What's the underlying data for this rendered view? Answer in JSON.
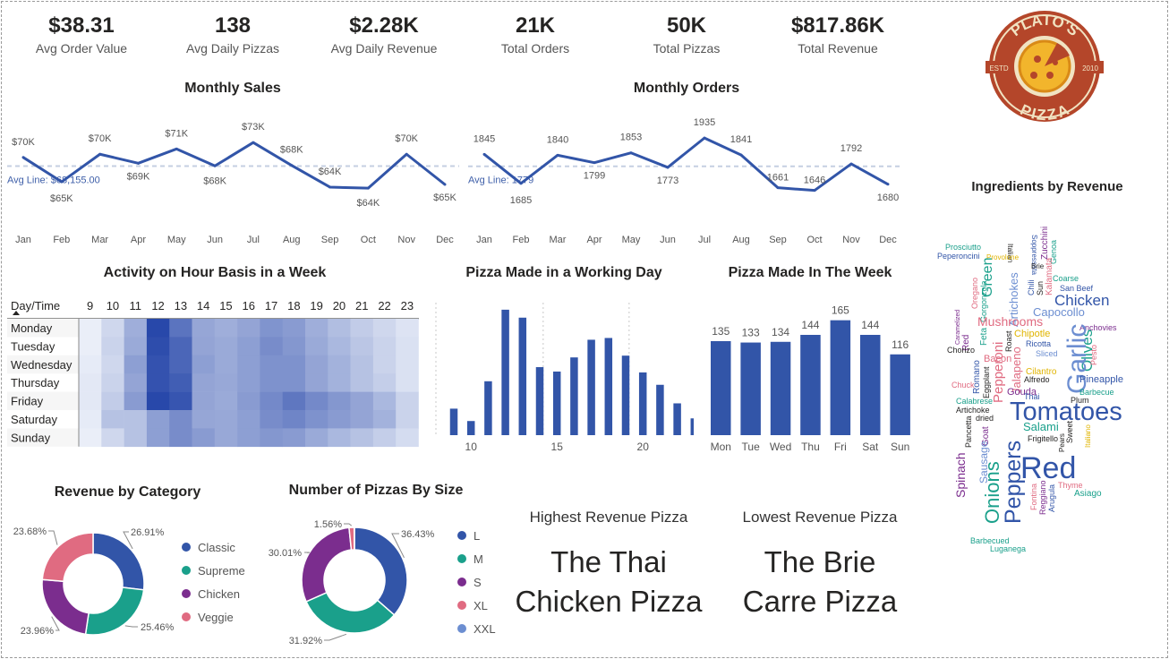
{
  "kpis": [
    {
      "value": "$38.31",
      "label": "Avg Order Value"
    },
    {
      "value": "138",
      "label": "Avg Daily Pizzas"
    },
    {
      "value": "$2.28K",
      "label": "Avg Daily Revenue"
    },
    {
      "value": "21K",
      "label": "Total Orders"
    },
    {
      "value": "50K",
      "label": "Total Pizzas"
    },
    {
      "value": "$817.86K",
      "label": "Total Revenue"
    }
  ],
  "logo": {
    "top_text": "PLATO'S",
    "bottom_text": "PIZZA",
    "left_text": "ESTD",
    "right_text": "2010"
  },
  "colors": {
    "primary": "#3255a8",
    "teal": "#1aa08b",
    "purple": "#7b2d8e",
    "pink": "#e06b81",
    "lightblue": "#6c8ed1",
    "avg_line": "#c5cfe2"
  },
  "highest": {
    "title": "Highest Revenue Pizza",
    "line1": "The Thai",
    "line2": "Chicken Pizza"
  },
  "lowest": {
    "title": "Lowest Revenue Pizza",
    "line1": "The Brie",
    "line2": "Carre Pizza"
  },
  "chart_data": [
    {
      "id": "monthly_sales",
      "type": "line",
      "title": "Monthly Sales",
      "categories": [
        "Jan",
        "Feb",
        "Mar",
        "Apr",
        "May",
        "Jun",
        "Jul",
        "Aug",
        "Sep",
        "Oct",
        "Nov",
        "Dec"
      ],
      "values": [
        69.8,
        65.2,
        70.4,
        68.7,
        71.4,
        68.2,
        72.6,
        68.3,
        64.2,
        64.0,
        70.4,
        64.7
      ],
      "data_labels": [
        "$70K",
        "$65K",
        "$70K",
        "$69K",
        "$71K",
        "$68K",
        "$73K",
        "$68K",
        "$64K",
        "$64K",
        "$70K",
        "$65K"
      ],
      "reference_line": {
        "label": "Avg Line: $68,155.00",
        "value": 68.155
      },
      "ylim": [
        62,
        75
      ]
    },
    {
      "id": "monthly_orders",
      "type": "line",
      "title": "Monthly Orders",
      "categories": [
        "Jan",
        "Feb",
        "Mar",
        "Apr",
        "May",
        "Jun",
        "Jul",
        "Aug",
        "Sep",
        "Oct",
        "Nov",
        "Dec"
      ],
      "values": [
        1845,
        1685,
        1840,
        1799,
        1853,
        1773,
        1935,
        1841,
        1661,
        1646,
        1792,
        1680
      ],
      "data_labels": [
        "1845",
        "1685",
        "1840",
        "1799",
        "1853",
        "1773",
        "1935",
        "1841",
        "1661",
        "1646",
        "1792",
        "1680"
      ],
      "reference_line": {
        "label": "Avg Line: 1779",
        "value": 1779
      },
      "ylim": [
        1600,
        1980
      ]
    },
    {
      "id": "hour_activity",
      "type": "heatmap",
      "title": "Activity on Hour Basis in a Week",
      "corner_label": "Day/Time",
      "x": [
        "9",
        "10",
        "11",
        "12",
        "13",
        "14",
        "15",
        "16",
        "17",
        "18",
        "19",
        "20",
        "21",
        "22",
        "23"
      ],
      "y": [
        "Monday",
        "Tuesday",
        "Wednesday",
        "Thursday",
        "Friday",
        "Saturday",
        "Sunday"
      ],
      "values": [
        [
          1,
          10,
          30,
          88,
          62,
          34,
          30,
          35,
          44,
          40,
          30,
          22,
          15,
          10,
          5
        ],
        [
          1,
          12,
          32,
          85,
          70,
          35,
          32,
          38,
          48,
          42,
          32,
          25,
          18,
          12,
          6
        ],
        [
          2,
          10,
          38,
          82,
          70,
          38,
          32,
          38,
          45,
          45,
          35,
          28,
          20,
          12,
          6
        ],
        [
          3,
          12,
          35,
          82,
          75,
          35,
          33,
          38,
          45,
          45,
          35,
          28,
          20,
          14,
          6
        ],
        [
          3,
          15,
          40,
          88,
          80,
          35,
          32,
          40,
          50,
          60,
          50,
          42,
          35,
          25,
          12
        ],
        [
          2,
          20,
          20,
          38,
          48,
          34,
          33,
          38,
          48,
          52,
          45,
          40,
          35,
          28,
          12
        ],
        [
          1,
          10,
          20,
          38,
          48,
          40,
          33,
          38,
          42,
          40,
          32,
          25,
          20,
          14,
          8
        ]
      ]
    },
    {
      "id": "pizza_working_day",
      "type": "bar",
      "title": "Pizza Made in a Working Day",
      "categories": [
        9,
        10,
        11,
        12,
        13,
        14,
        15,
        16,
        17,
        18,
        19,
        20,
        21,
        22,
        23
      ],
      "values": [
        30,
        16,
        61,
        142,
        133,
        77,
        72,
        88,
        108,
        110,
        90,
        71,
        57,
        36,
        19
      ],
      "tick_labels": [
        "10",
        "15",
        "20"
      ],
      "ylim": [
        0,
        150
      ]
    },
    {
      "id": "pizza_week",
      "type": "bar",
      "title": "Pizza Made In The Week",
      "categories": [
        "Mon",
        "Tue",
        "Wed",
        "Thu",
        "Fri",
        "Sat",
        "Sun"
      ],
      "values": [
        135,
        133,
        134,
        144,
        165,
        144,
        116
      ],
      "data_labels": [
        "135",
        "133",
        "134",
        "144",
        "165",
        "144",
        "116"
      ],
      "ylim": [
        0,
        180
      ]
    },
    {
      "id": "revenue_category",
      "type": "pie",
      "title": "Revenue by Category",
      "labels": [
        "Classic",
        "Supreme",
        "Chicken",
        "Veggie"
      ],
      "values": [
        26.91,
        25.46,
        23.96,
        23.68
      ],
      "data_labels": [
        "26.91%",
        "25.46%",
        "23.96%",
        "23.68%"
      ],
      "colors": [
        "#3255a8",
        "#1aa08b",
        "#7b2d8e",
        "#e06b81"
      ]
    },
    {
      "id": "pizzas_size",
      "type": "pie",
      "title": "Number of Pizzas By Size",
      "labels": [
        "L",
        "M",
        "S",
        "XL",
        "XXL"
      ],
      "values": [
        36.43,
        31.92,
        30.01,
        1.56,
        0.08
      ],
      "data_labels": [
        "36.43%",
        "31.92%",
        "30.01%",
        "1.56%",
        ""
      ],
      "colors": [
        "#3255a8",
        "#1aa08b",
        "#7b2d8e",
        "#e06b81",
        "#6c8ed1"
      ]
    }
  ],
  "wordcloud": {
    "title": "Ingredients by Revenue",
    "words": [
      {
        "t": "Prosciutto",
        "x": 1056,
        "y": 279,
        "s": 9,
        "c": "#1aa08b",
        "r": 0
      },
      {
        "t": "Peperoncini",
        "x": 1047,
        "y": 289,
        "s": 9,
        "c": "#3255a8",
        "r": 0
      },
      {
        "t": "Italian",
        "x": 1126,
        "y": 272,
        "s": 8,
        "c": "#252423",
        "r": 90
      },
      {
        "t": "Soppressata",
        "x": 1153,
        "y": 262,
        "s": 8,
        "c": "#3255a8",
        "r": 90
      },
      {
        "t": "Zucchini",
        "x": 1170,
        "y": 290,
        "s": 10,
        "c": "#7b2d8e",
        "r": -90
      },
      {
        "t": "Genoa",
        "x": 1180,
        "y": 295,
        "s": 9,
        "c": "#1aa08b",
        "r": -90
      },
      {
        "t": "Provolone",
        "x": 1102,
        "y": 290,
        "s": 8,
        "c": "#e0b400",
        "r": 0
      },
      {
        "t": "Green",
        "x": 1108,
        "y": 332,
        "s": 16,
        "c": "#1aa08b",
        "r": -90
      },
      {
        "t": "Artichokes",
        "x": 1137,
        "y": 365,
        "s": 13,
        "c": "#6c8ed1",
        "r": -90
      },
      {
        "t": "Brie",
        "x": 1152,
        "y": 300,
        "s": 8,
        "c": "#252423",
        "r": 0
      },
      {
        "t": "Chili",
        "x": 1155,
        "y": 330,
        "s": 9,
        "c": "#3255a8",
        "r": -90
      },
      {
        "t": "Sun",
        "x": 1165,
        "y": 330,
        "s": 9,
        "c": "#252423",
        "r": -90
      },
      {
        "t": "Kalamata",
        "x": 1175,
        "y": 330,
        "s": 10,
        "c": "#e06b81",
        "r": -90
      },
      {
        "t": "Coarse",
        "x": 1176,
        "y": 314,
        "s": 9,
        "c": "#1aa08b",
        "r": 0
      },
      {
        "t": "San Beef",
        "x": 1184,
        "y": 325,
        "s": 9,
        "c": "#3255a8",
        "r": 0
      },
      {
        "t": "Chicken",
        "x": 1178,
        "y": 341,
        "s": 17,
        "c": "#3255a8",
        "r": 0
      },
      {
        "t": "Capocollo",
        "x": 1154,
        "y": 353,
        "s": 13,
        "c": "#6c8ed1",
        "r": 0
      },
      {
        "t": "Oregano",
        "x": 1092,
        "y": 345,
        "s": 9,
        "c": "#e06b81",
        "r": -90
      },
      {
        "t": "Gorgonzola",
        "x": 1102,
        "y": 360,
        "s": 9,
        "c": "#1aa08b",
        "r": -90
      },
      {
        "t": "Mushrooms",
        "x": 1092,
        "y": 364,
        "s": 14,
        "c": "#e06b81",
        "r": 0
      },
      {
        "t": "Caramelized",
        "x": 1072,
        "y": 385,
        "s": 7,
        "c": "#7b2d8e",
        "r": -90
      },
      {
        "t": "Anchovies",
        "x": 1206,
        "y": 369,
        "s": 9,
        "c": "#7b2d8e",
        "r": 0
      },
      {
        "t": "Chipotle",
        "x": 1133,
        "y": 376,
        "s": 11,
        "c": "#e0b400",
        "r": 0
      },
      {
        "t": "Olives",
        "x": 1220,
        "y": 415,
        "s": 17,
        "c": "#1aa08b",
        "r": -90
      },
      {
        "t": "Feta",
        "x": 1102,
        "y": 386,
        "s": 10,
        "c": "#1aa08b",
        "r": -90
      },
      {
        "t": "Red",
        "x": 1082,
        "y": 392,
        "s": 10,
        "c": "#7b2d8e",
        "r": -90
      },
      {
        "t": "Ricotta",
        "x": 1146,
        "y": 387,
        "s": 9,
        "c": "#3255a8",
        "r": 0
      },
      {
        "t": "Chorizo",
        "x": 1058,
        "y": 394,
        "s": 9,
        "c": "#252423",
        "r": 0
      },
      {
        "t": "Sliced",
        "x": 1157,
        "y": 398,
        "s": 9,
        "c": "#6c8ed1",
        "r": 0
      },
      {
        "t": "Garlic",
        "x": 1213,
        "y": 440,
        "s": 30,
        "c": "#6c8ed1",
        "r": -90
      },
      {
        "t": "Roast",
        "x": 1130,
        "y": 393,
        "s": 9,
        "c": "#252423",
        "r": -90
      },
      {
        "t": "Bacon",
        "x": 1099,
        "y": 404,
        "s": 11,
        "c": "#e06b81",
        "r": 0
      },
      {
        "t": "Pesto",
        "x": 1225,
        "y": 408,
        "s": 9,
        "c": "#e06b81",
        "r": -90
      },
      {
        "t": "Jalapeno",
        "x": 1140,
        "y": 440,
        "s": 13,
        "c": "#e06b81",
        "r": -90
      },
      {
        "t": "Cilantro",
        "x": 1146,
        "y": 418,
        "s": 10,
        "c": "#e0b400",
        "r": 0
      },
      {
        "t": "Pineapple",
        "x": 1206,
        "y": 427,
        "s": 11,
        "c": "#3255a8",
        "r": 0
      },
      {
        "t": "Alfredo",
        "x": 1144,
        "y": 427,
        "s": 9,
        "c": "#252423",
        "r": 0
      },
      {
        "t": "Chuck",
        "x": 1063,
        "y": 433,
        "s": 9,
        "c": "#e06b81",
        "r": 0
      },
      {
        "t": "Romano",
        "x": 1094,
        "y": 440,
        "s": 10,
        "c": "#3255a8",
        "r": -90
      },
      {
        "t": "Pepperoni",
        "x": 1120,
        "y": 450,
        "s": 15,
        "c": "#e06b81",
        "r": -90
      },
      {
        "t": "Gouda",
        "x": 1125,
        "y": 441,
        "s": 11,
        "c": "#7b2d8e",
        "r": 0
      },
      {
        "t": "Barbecue",
        "x": 1206,
        "y": 441,
        "s": 9,
        "c": "#1aa08b",
        "r": 0
      },
      {
        "t": "Calabrese",
        "x": 1068,
        "y": 451,
        "s": 9,
        "c": "#1aa08b",
        "r": 0
      },
      {
        "t": "Eggplant",
        "x": 1105,
        "y": 445,
        "s": 9,
        "c": "#252423",
        "r": -90
      },
      {
        "t": "Thai",
        "x": 1144,
        "y": 446,
        "s": 9,
        "c": "#3255a8",
        "r": 0
      },
      {
        "t": "Plum",
        "x": 1196,
        "y": 450,
        "s": 9,
        "c": "#252423",
        "r": 0
      },
      {
        "t": "Artichoke",
        "x": 1068,
        "y": 461,
        "s": 9,
        "c": "#252423",
        "r": 0
      },
      {
        "t": "Tomatoes",
        "x": 1128,
        "y": 469,
        "s": 29,
        "c": "#3255a8",
        "r": 0
      },
      {
        "t": "dried",
        "x": 1090,
        "y": 470,
        "s": 9,
        "c": "#252423",
        "r": 0
      },
      {
        "t": "Salami",
        "x": 1143,
        "y": 481,
        "s": 13,
        "c": "#1aa08b",
        "r": 0
      },
      {
        "t": "Pancetta",
        "x": 1085,
        "y": 500,
        "s": 9,
        "c": "#252423",
        "r": -90
      },
      {
        "t": "Goat",
        "x": 1104,
        "y": 498,
        "s": 10,
        "c": "#7b2d8e",
        "r": -90
      },
      {
        "t": "Onions",
        "x": 1116,
        "y": 585,
        "s": 22,
        "c": "#1aa08b",
        "r": -90
      },
      {
        "t": "Peppers",
        "x": 1140,
        "y": 585,
        "s": 25,
        "c": "#3255a8",
        "r": -90
      },
      {
        "t": "Red",
        "x": 1140,
        "y": 534,
        "s": 34,
        "c": "#3255a8",
        "r": 0
      },
      {
        "t": "Frigitello",
        "x": 1148,
        "y": 493,
        "s": 9,
        "c": "#252423",
        "r": 0
      },
      {
        "t": "Sweet",
        "x": 1198,
        "y": 495,
        "s": 9,
        "c": "#252423",
        "r": -90
      },
      {
        "t": "Italiano",
        "x": 1218,
        "y": 500,
        "s": 8,
        "c": "#e0b400",
        "r": -90
      },
      {
        "t": "Pears",
        "x": 1189,
        "y": 505,
        "s": 8,
        "c": "#252423",
        "r": -90
      },
      {
        "t": "Spinach",
        "x": 1078,
        "y": 556,
        "s": 14,
        "c": "#7b2d8e",
        "r": -90
      },
      {
        "t": "Sausage",
        "x": 1103,
        "y": 540,
        "s": 12,
        "c": "#6c8ed1",
        "r": -90
      },
      {
        "t": "Thyme",
        "x": 1182,
        "y": 545,
        "s": 9,
        "c": "#e06b81",
        "r": 0
      },
      {
        "t": "Asiago",
        "x": 1200,
        "y": 554,
        "s": 10,
        "c": "#1aa08b",
        "r": 0
      },
      {
        "t": "Fontina",
        "x": 1158,
        "y": 570,
        "s": 9,
        "c": "#e06b81",
        "r": -90
      },
      {
        "t": "Reggiano",
        "x": 1168,
        "y": 575,
        "s": 9,
        "c": "#7b2d8e",
        "r": -90
      },
      {
        "t": "Arugula",
        "x": 1178,
        "y": 572,
        "s": 9,
        "c": "#3255a8",
        "r": -90
      },
      {
        "t": "Barbecued",
        "x": 1084,
        "y": 607,
        "s": 9,
        "c": "#1aa08b",
        "r": 0
      },
      {
        "t": "Luganega",
        "x": 1106,
        "y": 616,
        "s": 9,
        "c": "#1aa08b",
        "r": 0
      }
    ]
  }
}
